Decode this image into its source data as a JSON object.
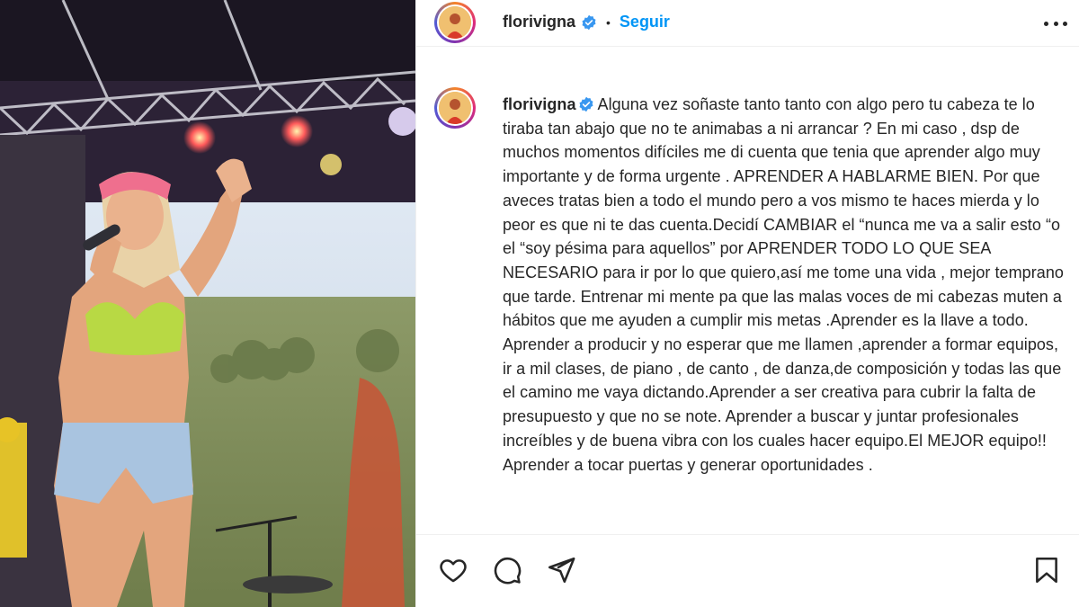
{
  "post": {
    "username": "florivigna",
    "follow_label": "Seguir",
    "separator": "•",
    "caption": "Alguna vez soñaste tanto tanto con algo pero tu cabeza te lo tiraba tan abajo que no te animabas a ni arrancar ? En mi caso , dsp de muchos momentos difíciles me di cuenta que tenia que aprender algo muy importante y de forma urgente . APRENDER A HABLARME BIEN. Por que aveces tratas bien a todo el mundo pero a vos mismo te haces mierda y lo peor es que ni te das cuenta.Decidí CAMBIAR el “nunca me va a salir esto “o el “soy pésima para aquellos” por APRENDER TODO LO QUE SEA NECESARIO para ir por lo que quiero,así me tome una vida , mejor temprano que tarde. Entrenar mi mente pa que las malas voces de mi cabezas muten a hábitos que me ayuden a cumplir mis metas .Aprender es la llave a todo. Aprender a producir y no esperar que me llamen ,aprender a formar equipos, ir a mil clases, de piano , de canto , de danza,de composición y todas las que el camino me vaya dictando.Aprender a ser creativa para cubrir la falta de presupuesto y que no se note. Aprender a buscar y juntar profesionales increíbles y de buena vibra con los cuales hacer equipo.El MEJOR equipo!! Aprender a tocar puertas y generar oportunidades ."
  },
  "icons": {
    "verified": "verified-badge-icon",
    "more": "more-options-icon",
    "like": "heart-icon",
    "comment": "comment-icon",
    "share": "paper-plane-icon",
    "save": "bookmark-icon"
  },
  "colors": {
    "link_blue": "#0095f6",
    "verified_blue": "#3897f0",
    "text": "#262626",
    "border": "#efefef"
  }
}
